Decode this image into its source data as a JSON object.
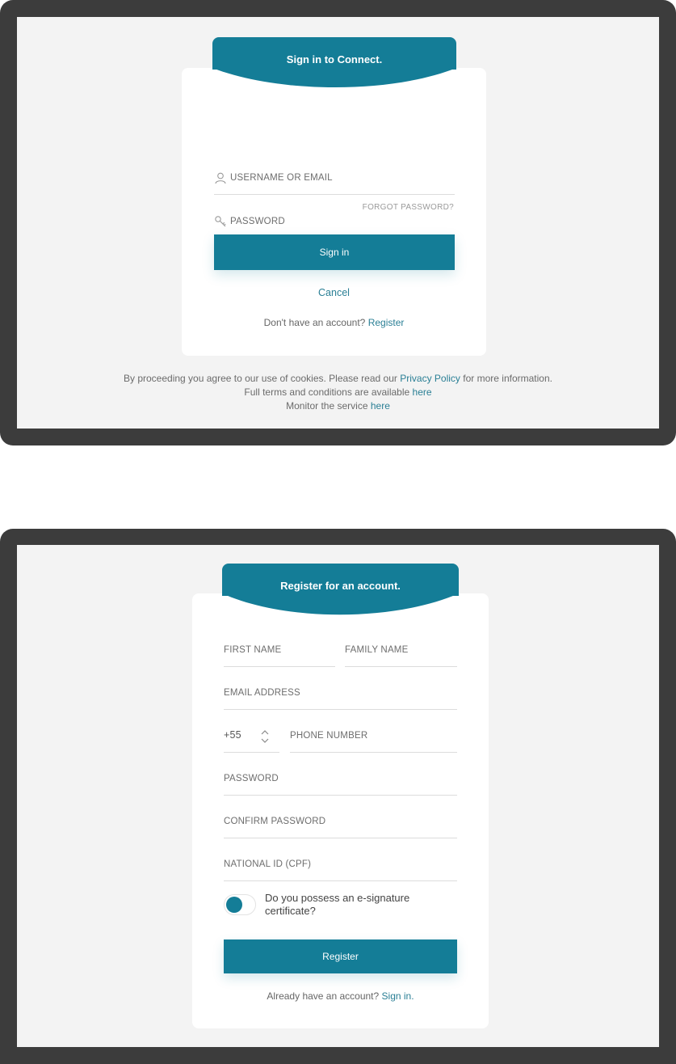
{
  "signin": {
    "title": "Sign in to Connect.",
    "username_label": "USERNAME OR EMAIL",
    "password_label": "PASSWORD",
    "forgot": "FORGOT PASSWORD?",
    "signin_button": "Sign in",
    "cancel": "Cancel",
    "no_account": "Don't have an account?",
    "register_link": "Register"
  },
  "footer": {
    "line1_pre": "By proceeding you agree to our use of cookies. Please read our",
    "privacy_link": "Privacy Policy",
    "line1_post": "for more information.",
    "line2_pre": "Full terms and conditions are available",
    "terms_link": "here",
    "line3_pre": "Monitor the service",
    "monitor_link": "here"
  },
  "register": {
    "title": "Register for an account.",
    "first_name": "FIRST NAME",
    "family_name": "FAMILY NAME",
    "email": "EMAIL ADDRESS",
    "country_code": "+55",
    "phone": "PHONE NUMBER",
    "password": "PASSWORD",
    "confirm_password": "CONFIRM PASSWORD",
    "national_id": "NATIONAL ID (CPF)",
    "esig_question": "Do you possess an e-signature certificate?",
    "register_button": "Register",
    "have_account": "Already have an account?",
    "signin_link": "Sign in."
  },
  "colors": {
    "accent": "#147d97",
    "frame": "#3c3c3c",
    "background": "#f3f3f3"
  },
  "icons": {
    "username": "user-icon",
    "password": "key-icon",
    "stepper": "chevron-up-down-icon"
  }
}
